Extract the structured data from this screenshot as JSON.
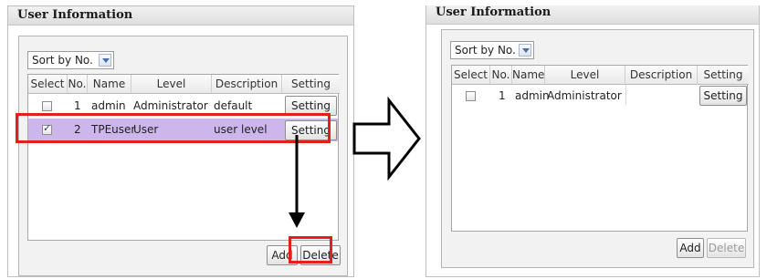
{
  "left": {
    "title": "User Information",
    "sort_label": "Sort by No.",
    "headers": [
      "Select",
      "No.",
      "Name",
      "Level",
      "Description",
      "Setting"
    ],
    "rows": [
      {
        "checked": false,
        "no": "1",
        "name": "admin",
        "level": "Administrator",
        "description": "default",
        "setting": "Setting",
        "selected": false
      },
      {
        "checked": true,
        "no": "2",
        "name": "TPEuser",
        "level": "User",
        "description": "user level",
        "setting": "Setting",
        "selected": true
      }
    ],
    "add_label": "Add",
    "delete_label": "Delete"
  },
  "right": {
    "title": "User Information",
    "sort_label": "Sort by No.",
    "headers": [
      "Select",
      "No.",
      "Name",
      "Level",
      "Description",
      "Setting"
    ],
    "rows": [
      {
        "checked": false,
        "no": "1",
        "name": "admin",
        "level": "Administrator",
        "description": "",
        "setting": "Setting"
      }
    ],
    "add_label": "Add",
    "delete_label": "Delete",
    "delete_disabled": true
  },
  "colors": {
    "highlight": "#e41d1d",
    "selected_row": "#cdb6ec",
    "arrow": "#000000"
  }
}
